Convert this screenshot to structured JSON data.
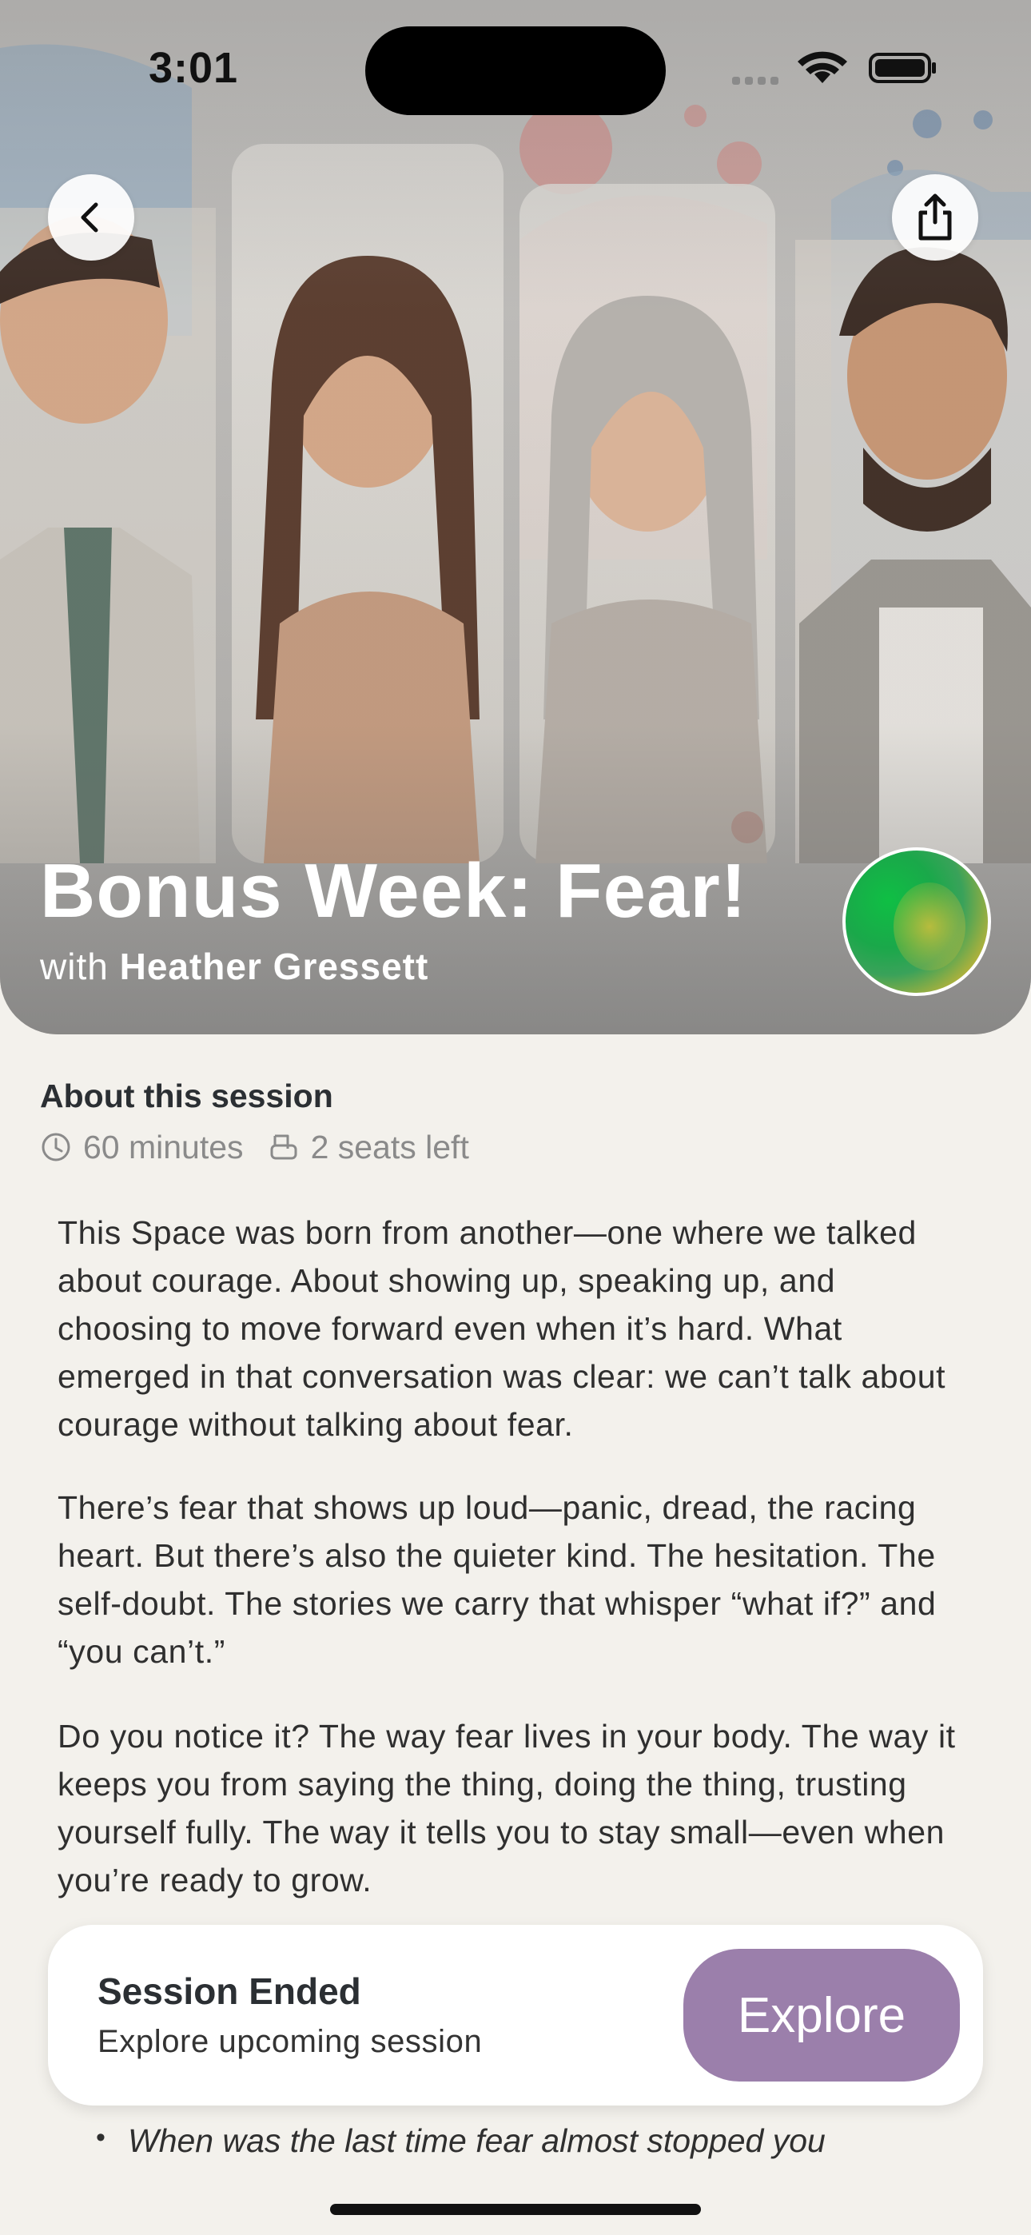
{
  "status_bar": {
    "time": "3:01"
  },
  "hero": {
    "title": "Bonus Week: Fear!",
    "host_prefix": "with",
    "host_name": "Heather Gressett"
  },
  "about": {
    "heading": "About this session",
    "duration": "60 minutes",
    "seats": "2 seats left"
  },
  "description": [
    "This Space was born from another—one where we talked about courage. About showing up, speaking up, and choosing to move forward even when it’s hard. What emerged in that conversation was clear: we can’t talk about courage without talking about fear.",
    "There’s fear that shows up loud—panic, dread, the racing heart. But there’s also the quieter kind. The hesitation. The self-doubt. The stories we carry that whisper “what if?” and “you can’t.”",
    "Do you notice it? The way fear lives in your body. The way it keeps you from saying the thing, doing the thing, trusting yourself fully. The way it tells you to stay small—even when you’re ready to grow."
  ],
  "bullet": "When was the last time fear almost stopped you",
  "card": {
    "title": "Session Ended",
    "subtitle": "Explore upcoming session",
    "button": "Explore",
    "button_color": "#9b7fab"
  },
  "icons": {
    "back": "chevron-left-icon",
    "share": "share-icon",
    "clock": "clock-icon",
    "seat": "seat-icon"
  }
}
